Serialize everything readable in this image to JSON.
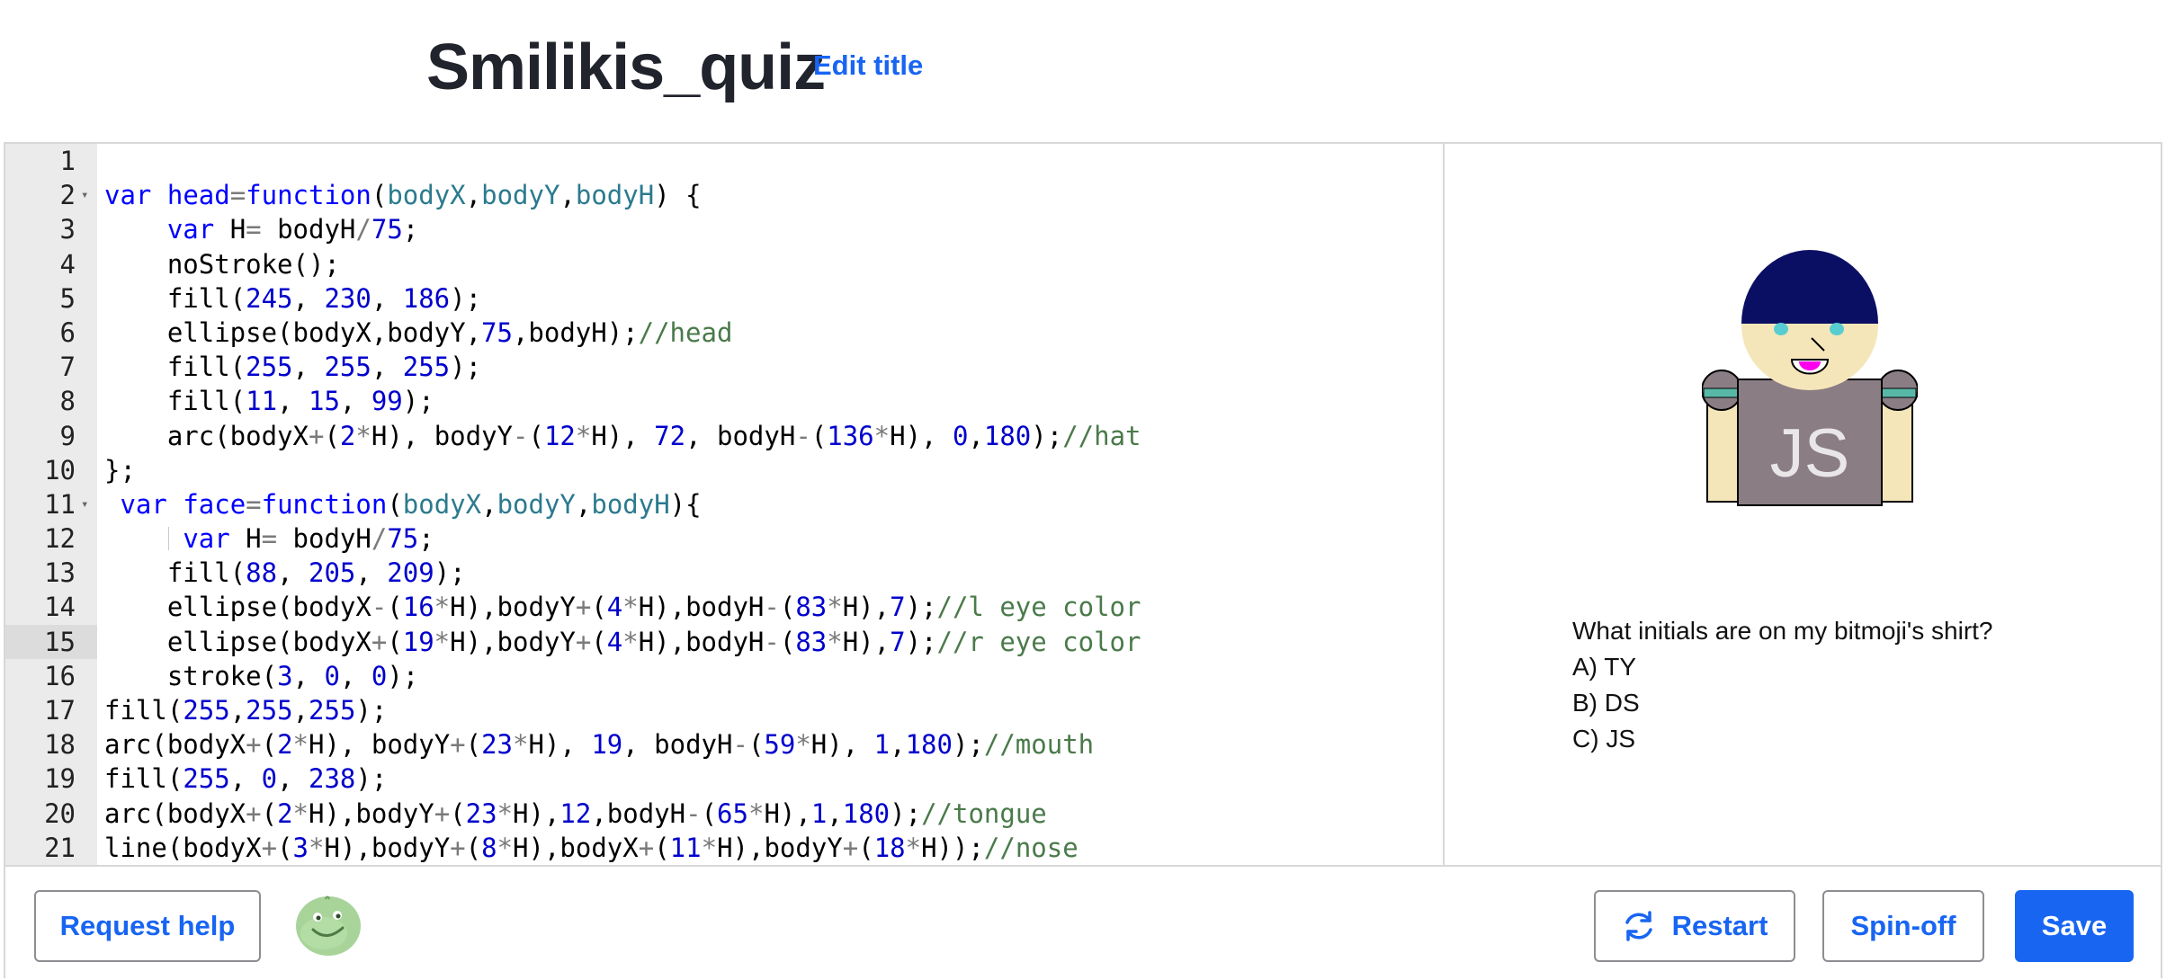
{
  "header": {
    "title": "Smilikis_quiz",
    "edit_title_label": "Edit title"
  },
  "editor": {
    "active_line": 15,
    "lines": [
      {
        "num": "1",
        "fold": false,
        "html": ""
      },
      {
        "num": "2",
        "fold": true,
        "html": "<span class='k'>var</span> <span class='k'>head</span><span class='o'>=</span><span class='k'>function</span>(<span class='p'>bodyX</span>,<span class='p'>bodyY</span>,<span class='p'>bodyH</span>) {"
      },
      {
        "num": "3",
        "fold": false,
        "html": "    <span class='k'>var</span> H<span class='o'>=</span> bodyH<span class='o'>/</span><span class='n'>75</span>;"
      },
      {
        "num": "4",
        "fold": false,
        "html": "    noStroke();"
      },
      {
        "num": "5",
        "fold": false,
        "html": "    fill(<span class='n'>245</span>, <span class='n'>230</span>, <span class='n'>186</span>);"
      },
      {
        "num": "6",
        "fold": false,
        "html": "    ellipse(bodyX,bodyY,<span class='n'>75</span>,bodyH);<span class='c'>//head</span>"
      },
      {
        "num": "7",
        "fold": false,
        "html": "    fill(<span class='n'>255</span>, <span class='n'>255</span>, <span class='n'>255</span>);"
      },
      {
        "num": "8",
        "fold": false,
        "html": "    fill(<span class='n'>11</span>, <span class='n'>15</span>, <span class='n'>99</span>);"
      },
      {
        "num": "9",
        "fold": false,
        "html": "    arc(bodyX<span class='o'>+</span>(<span class='n'>2</span><span class='o'>*</span>H), bodyY<span class='o'>-</span>(<span class='n'>12</span><span class='o'>*</span>H), <span class='n'>72</span>, bodyH<span class='o'>-</span>(<span class='n'>136</span><span class='o'>*</span>H), <span class='n'>0</span>,<span class='n'>180</span>);<span class='c'>//hat</span>"
      },
      {
        "num": "10",
        "fold": false,
        "html": "};"
      },
      {
        "num": "11",
        "fold": true,
        "html": " <span class='k'>var</span> <span class='k'>face</span><span class='o'>=</span><span class='k'>function</span>(<span class='p'>bodyX</span>,<span class='p'>bodyY</span>,<span class='p'>bodyH</span>){"
      },
      {
        "num": "12",
        "fold": false,
        "guide": true,
        "html": "     <span class='k'>var</span> H<span class='o'>=</span> bodyH<span class='o'>/</span><span class='n'>75</span>;"
      },
      {
        "num": "13",
        "fold": false,
        "html": "    fill(<span class='n'>88</span>, <span class='n'>205</span>, <span class='n'>209</span>);"
      },
      {
        "num": "14",
        "fold": false,
        "html": "    ellipse(bodyX<span class='o'>-</span>(<span class='n'>16</span><span class='o'>*</span>H),bodyY<span class='o'>+</span>(<span class='n'>4</span><span class='o'>*</span>H),bodyH<span class='o'>-</span>(<span class='n'>83</span><span class='o'>*</span>H),<span class='n'>7</span>);<span class='c'>//l eye color</span>"
      },
      {
        "num": "15",
        "fold": false,
        "html": "    ellipse(bodyX<span class='o'>+</span>(<span class='n'>19</span><span class='o'>*</span>H),bodyY<span class='o'>+</span>(<span class='n'>4</span><span class='o'>*</span>H),bodyH<span class='o'>-</span>(<span class='n'>83</span><span class='o'>*</span>H),<span class='n'>7</span>);<span class='c'>//r eye color</span>"
      },
      {
        "num": "16",
        "fold": false,
        "html": "    stroke(<span class='n'>3</span>, <span class='n'>0</span>, <span class='n'>0</span>);"
      },
      {
        "num": "17",
        "fold": false,
        "html": "fill(<span class='n'>255</span>,<span class='n'>255</span>,<span class='n'>255</span>);"
      },
      {
        "num": "18",
        "fold": false,
        "html": "arc(bodyX<span class='o'>+</span>(<span class='n'>2</span><span class='o'>*</span>H), bodyY<span class='o'>+</span>(<span class='n'>23</span><span class='o'>*</span>H), <span class='n'>19</span>, bodyH<span class='o'>-</span>(<span class='n'>59</span><span class='o'>*</span>H), <span class='n'>1</span>,<span class='n'>180</span>);<span class='c'>//mouth</span>"
      },
      {
        "num": "19",
        "fold": false,
        "html": "fill(<span class='n'>255</span>, <span class='n'>0</span>, <span class='n'>238</span>);"
      },
      {
        "num": "20",
        "fold": false,
        "html": "arc(bodyX<span class='o'>+</span>(<span class='n'>2</span><span class='o'>*</span>H),bodyY<span class='o'>+</span>(<span class='n'>23</span><span class='o'>*</span>H),<span class='n'>12</span>,bodyH<span class='o'>-</span>(<span class='n'>65</span><span class='o'>*</span>H),<span class='n'>1</span>,<span class='n'>180</span>);<span class='c'>//tongue</span>"
      },
      {
        "num": "21",
        "fold": false,
        "html": "line(bodyX<span class='o'>+</span>(<span class='n'>3</span><span class='o'>*</span>H),bodyY<span class='o'>+</span>(<span class='n'>8</span><span class='o'>*</span>H),bodyX<span class='o'>+</span>(<span class='n'>11</span><span class='o'>*</span>H),bodyY<span class='o'>+</span>(<span class='n'>18</span><span class='o'>*</span>H));<span class='c'>//nose</span>"
      }
    ]
  },
  "output": {
    "shirt_text": "JS",
    "quiz": {
      "question": "What initials are on my bitmoji's shirt?",
      "options": [
        "A) TY",
        "B) DS",
        "C) JS"
      ]
    },
    "colors": {
      "skin": "#f5e6ba",
      "hat": "#0b0f63",
      "eyes": "#58cdd1",
      "tongue": "#ff00ee",
      "shirt": "#8a7d84",
      "collar": "#58b8a8"
    }
  },
  "footer": {
    "request_help_label": "Request help",
    "avatar_icon": "green-blob-avatar-icon",
    "restart_label": "Restart",
    "restart_icon": "refresh-icon",
    "spinoff_label": "Spin-off",
    "save_label": "Save"
  }
}
